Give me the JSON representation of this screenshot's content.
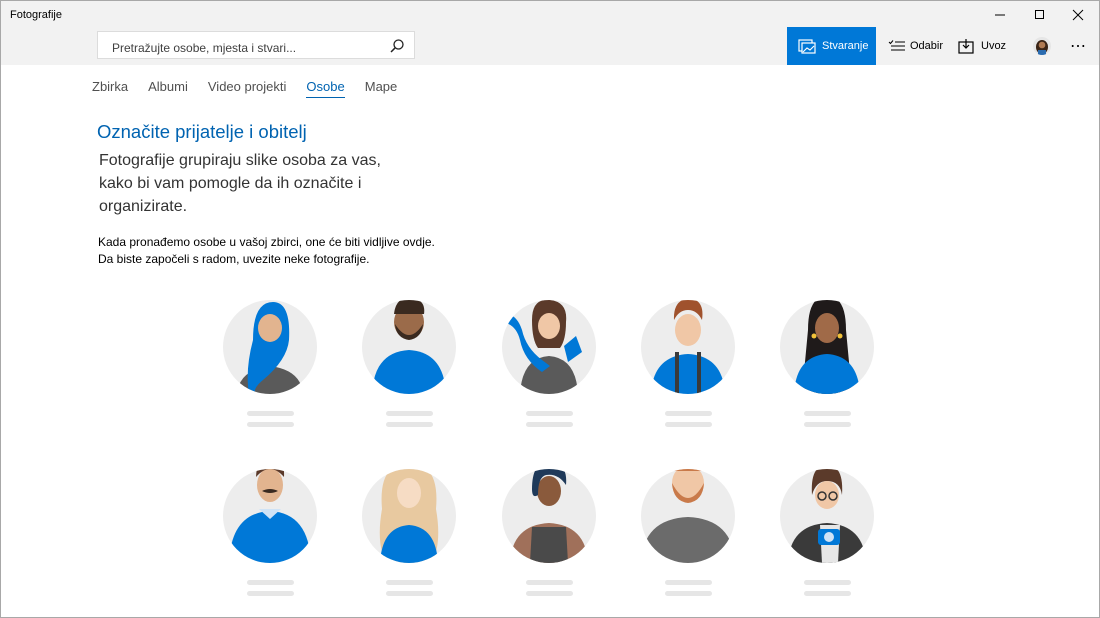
{
  "app": {
    "title": "Fotografije"
  },
  "search": {
    "placeholder": "Pretražujte osobe, mjesta i stvari..."
  },
  "toolbar": {
    "create_label": "Stvaranje",
    "select_label": "Odabir",
    "import_label": "Uvoz",
    "more_label": "⋯"
  },
  "tabs": [
    {
      "label": "Zbirka"
    },
    {
      "label": "Albumi"
    },
    {
      "label": "Video projekti"
    },
    {
      "label": "Osobe"
    },
    {
      "label": "Mape"
    }
  ],
  "active_tab": "Osobe",
  "main": {
    "heading": "Označite prijatelje i obitelj",
    "subheading": "Fotografije grupiraju slike osoba za vas, kako bi vam pomogle da ih označite i organizirate.",
    "body_line1": "Kada pronađemo osobe u vašoj zbirci, one će biti vidljive ovdje.",
    "body_line2": "Da biste započeli s radom, uvezite neke fotografije."
  },
  "colors": {
    "accent": "#0078d7",
    "link": "#0063b1",
    "chrome": "#f2f2f2",
    "placeholder": "#e6e6e6"
  }
}
